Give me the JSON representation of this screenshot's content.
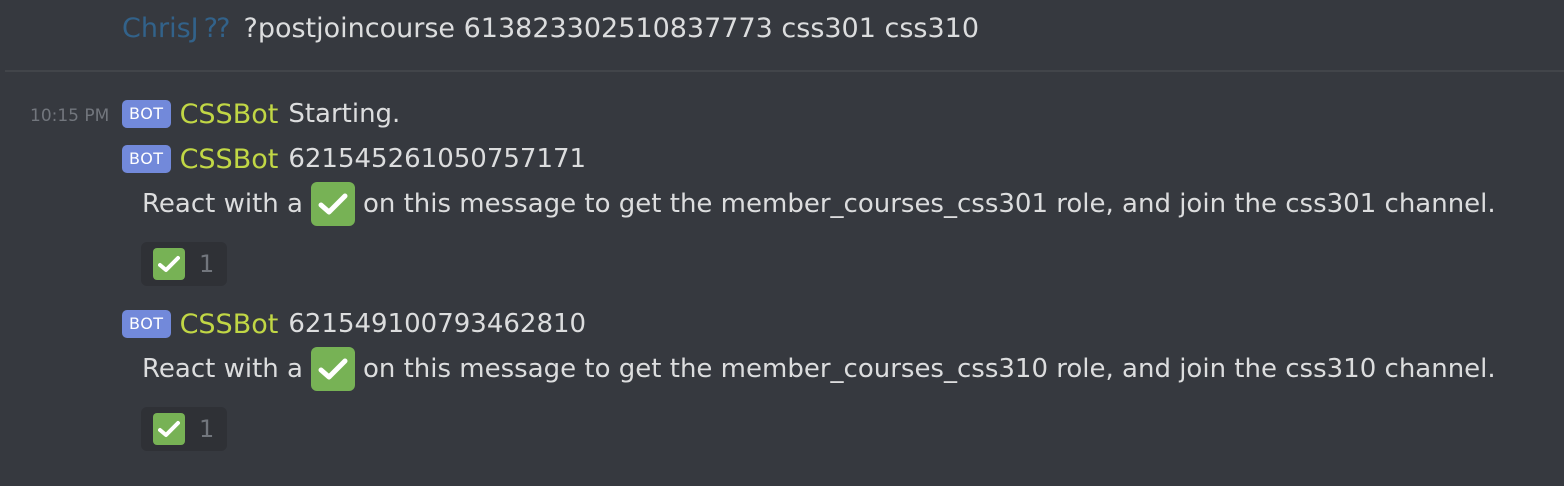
{
  "previous_message": {
    "author": "ChrisJ",
    "author_badge": "⁇",
    "text": "?postjoincourse 613823302510837773 css301 css310"
  },
  "group": {
    "timestamp": "10:15 PM"
  },
  "messages": [
    {
      "bot_tag": "BOT",
      "username": "CSSBot",
      "text": "Starting."
    },
    {
      "bot_tag": "BOT",
      "username": "CSSBot",
      "text": "621545261050757171",
      "body_before": "React with a",
      "body_after": "on this message to get the member_courses_css301 role, and join the css301 channel.",
      "reaction_emoji": "white-check-mark",
      "reaction_count": "1"
    },
    {
      "bot_tag": "BOT",
      "username": "CSSBot",
      "text": "621549100793462810",
      "body_before": "React with a",
      "body_after": "on this message to get the member_courses_css310 role, and join the css310 channel.",
      "reaction_emoji": "white-check-mark",
      "reaction_count": "1"
    }
  ],
  "colors": {
    "background": "#36393f",
    "bot_tag": "#7289da",
    "bot_username": "#c1d745",
    "prev_author": "#32628a",
    "check_green": "#77b255"
  }
}
